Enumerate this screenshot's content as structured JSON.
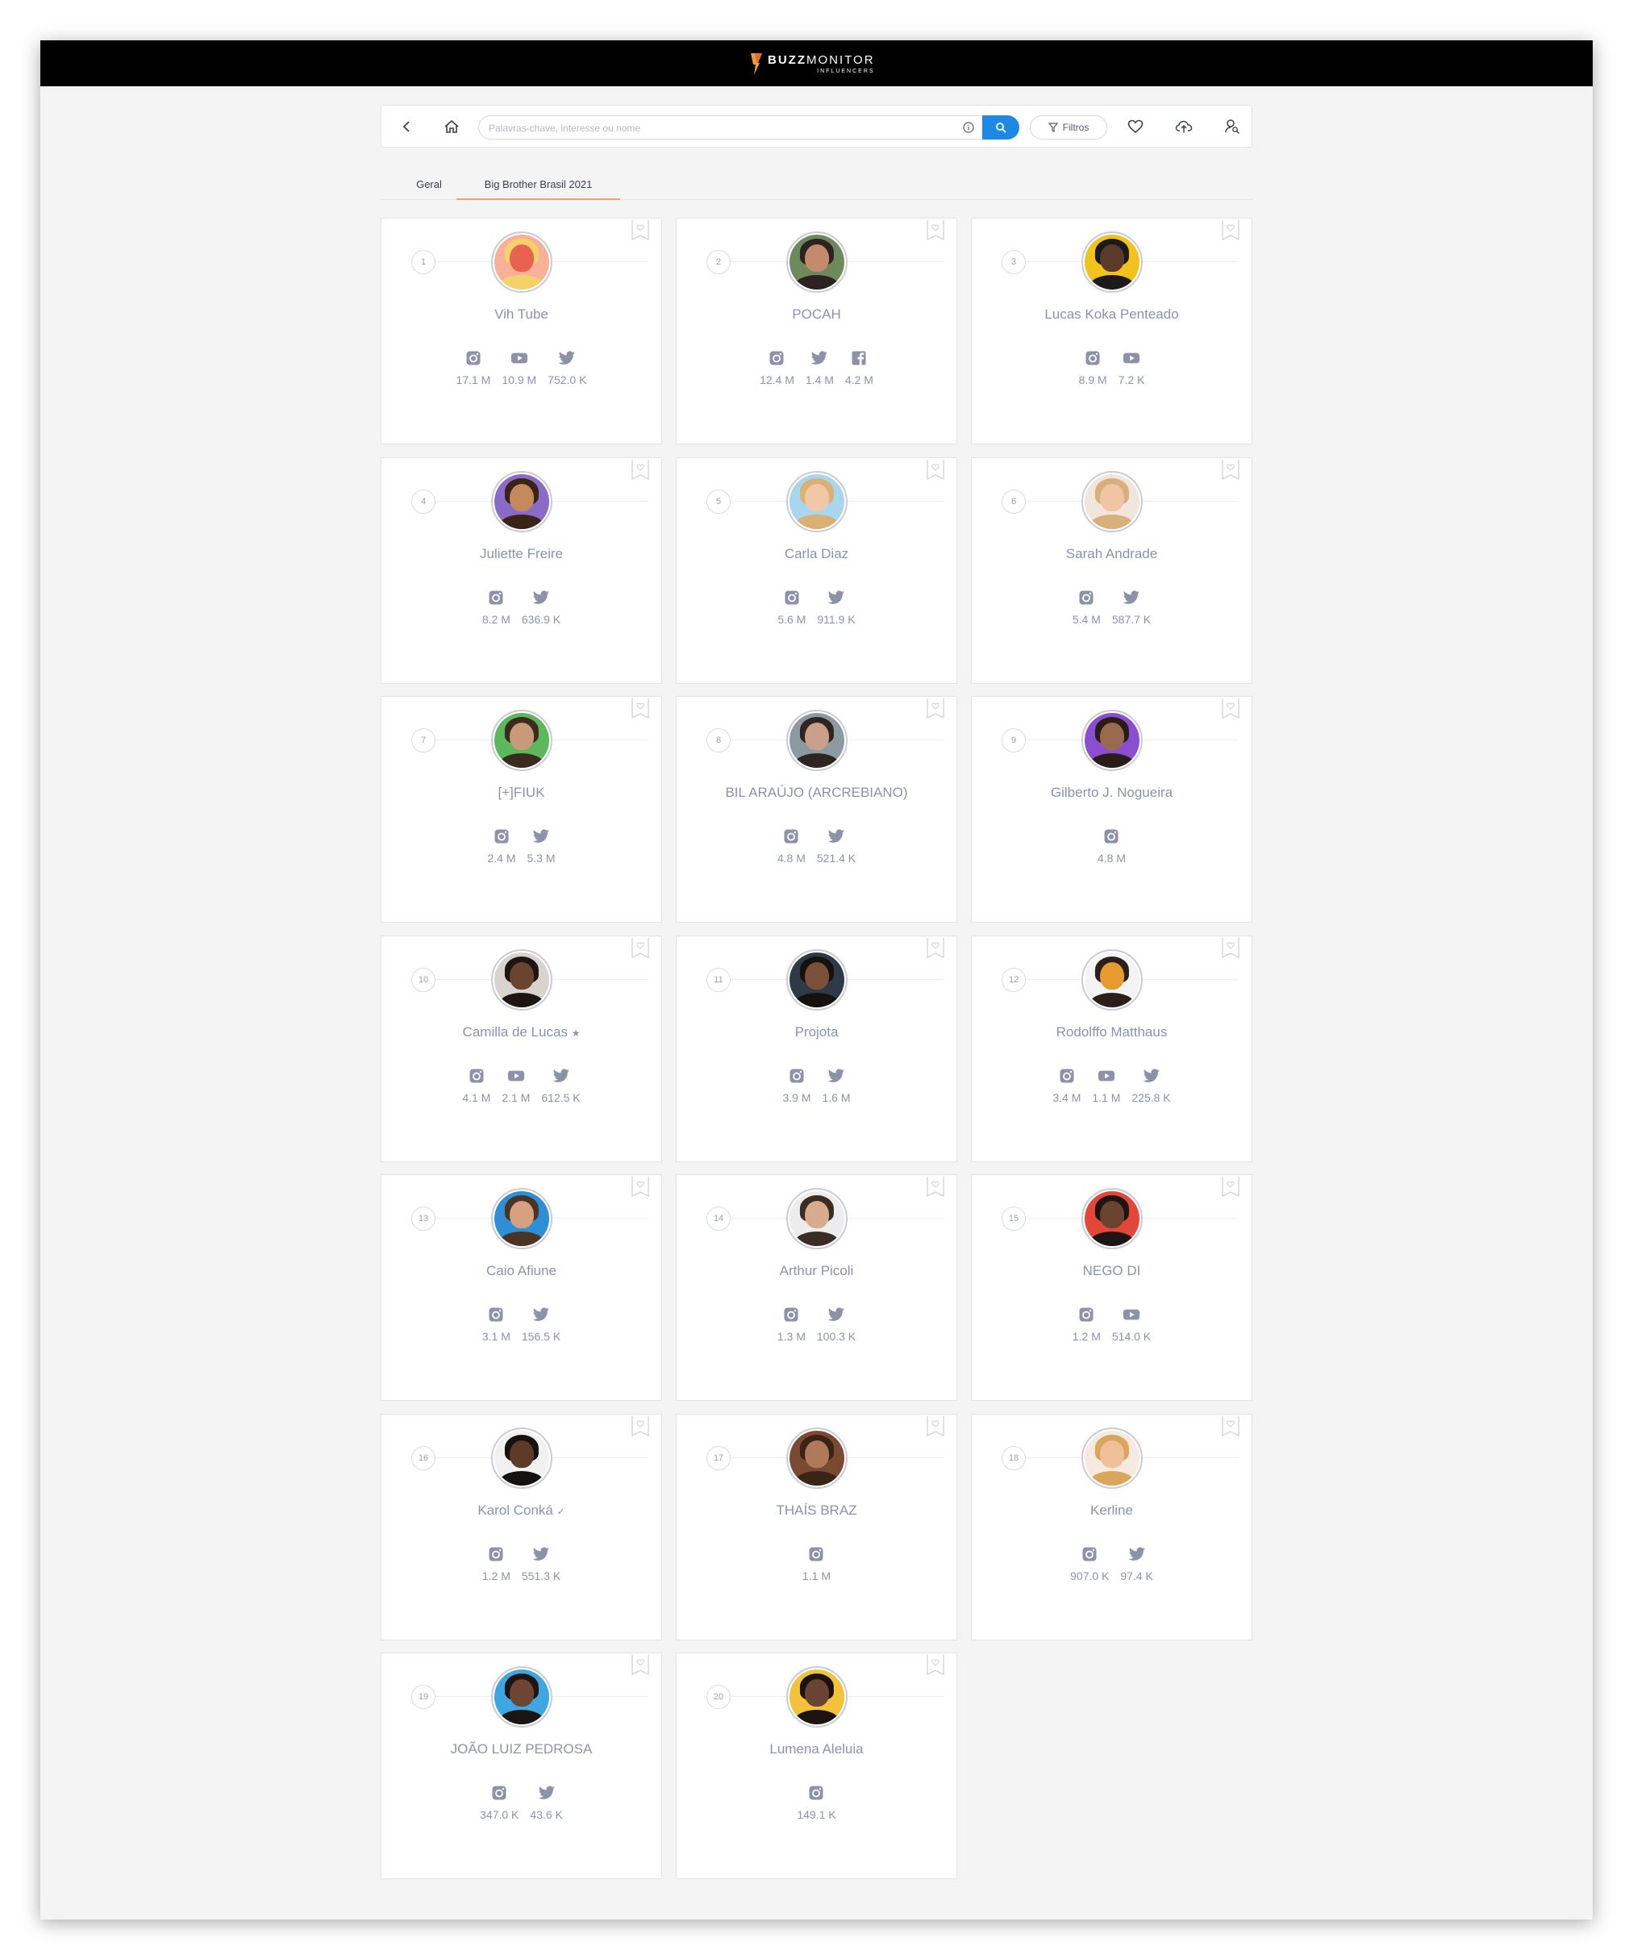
{
  "app": {
    "brand_bold": "BUZZ",
    "brand_rest": "MONITOR",
    "brand_sub": "INFLUENCERS"
  },
  "toolbar": {
    "search_placeholder": "Palavras-chave, interesse ou nome",
    "search_value": "",
    "filters_label": "Filtros"
  },
  "tabs": [
    {
      "label": "Geral",
      "active": false
    },
    {
      "label": "Big Brother Brasil 2021",
      "active": true
    }
  ],
  "influencers": [
    {
      "rank": "1",
      "name": "Vih Tube",
      "badge": "",
      "colors": [
        "#f7b199",
        "#f5d16a",
        "#e9624f"
      ],
      "stats": [
        {
          "network": "instagram-icon",
          "value": "17.1 M"
        },
        {
          "network": "youtube-icon",
          "value": "10.9 M"
        },
        {
          "network": "twitter-icon",
          "value": "752.0 K"
        }
      ]
    },
    {
      "rank": "2",
      "name": "POCAH",
      "badge": "",
      "colors": [
        "#6e8a5c",
        "#2b2320",
        "#c58a6d"
      ],
      "stats": [
        {
          "network": "instagram-icon",
          "value": "12.4 M"
        },
        {
          "network": "twitter-icon",
          "value": "1.4 M"
        },
        {
          "network": "facebook-icon",
          "value": "4.2 M"
        }
      ]
    },
    {
      "rank": "3",
      "name": "Lucas Koka Penteado",
      "badge": "",
      "colors": [
        "#f2c31a",
        "#1b1b1b",
        "#5a3a28"
      ],
      "stats": [
        {
          "network": "instagram-icon",
          "value": "8.9 M"
        },
        {
          "network": "youtube-icon",
          "value": "7.2 K"
        }
      ]
    },
    {
      "rank": "4",
      "name": "Juliette Freire",
      "badge": "",
      "colors": [
        "#8a6cc8",
        "#3a2418",
        "#c48a5c"
      ],
      "stats": [
        {
          "network": "instagram-icon",
          "value": "8.2 M"
        },
        {
          "network": "twitter-icon",
          "value": "636.9 K"
        }
      ]
    },
    {
      "rank": "5",
      "name": "Carla Diaz",
      "badge": "",
      "colors": [
        "#a9d6ee",
        "#d9b273",
        "#f0c8a8"
      ],
      "stats": [
        {
          "network": "instagram-icon",
          "value": "5.6 M"
        },
        {
          "network": "twitter-icon",
          "value": "911.9 K"
        }
      ]
    },
    {
      "rank": "6",
      "name": "Sarah Andrade",
      "badge": "",
      "colors": [
        "#f1e6dd",
        "#d8b07c",
        "#efc5a3"
      ],
      "stats": [
        {
          "network": "instagram-icon",
          "value": "5.4 M"
        },
        {
          "network": "twitter-icon",
          "value": "587.7 K"
        }
      ]
    },
    {
      "rank": "7",
      "name": "[+]FIUK",
      "badge": "",
      "colors": [
        "#5cb85c",
        "#3b2a1e",
        "#c89a78"
      ],
      "stats": [
        {
          "network": "instagram-icon",
          "value": "2.4 M"
        },
        {
          "network": "twitter-icon",
          "value": "5.3 M"
        }
      ]
    },
    {
      "rank": "8",
      "name": "BIL ARAÚJO (ARCREBIANO)",
      "badge": "",
      "colors": [
        "#8e9aa1",
        "#2e2520",
        "#caa08a"
      ],
      "stats": [
        {
          "network": "instagram-icon",
          "value": "4.8 M"
        },
        {
          "network": "twitter-icon",
          "value": "521.4 K"
        }
      ]
    },
    {
      "rank": "9",
      "name": "Gilberto J. Nogueira",
      "badge": "",
      "colors": [
        "#8a4fd1",
        "#2a1d17",
        "#9a6a4e"
      ],
      "stats": [
        {
          "network": "instagram-icon",
          "value": "4.8 M"
        }
      ]
    },
    {
      "rank": "10",
      "name": "Camilla de Lucas",
      "badge": "★",
      "colors": [
        "#d8d3cf",
        "#1c1512",
        "#6b4430"
      ],
      "stats": [
        {
          "network": "instagram-icon",
          "value": "4.1 M"
        },
        {
          "network": "youtube-icon",
          "value": "2.1 M"
        },
        {
          "network": "twitter-icon",
          "value": "612.5 K"
        }
      ]
    },
    {
      "rank": "11",
      "name": "Projota",
      "badge": "",
      "colors": [
        "#2f3a48",
        "#15110f",
        "#7a5038"
      ],
      "stats": [
        {
          "network": "instagram-icon",
          "value": "3.9 M"
        },
        {
          "network": "twitter-icon",
          "value": "1.6 M"
        }
      ]
    },
    {
      "rank": "12",
      "name": "Rodolffo Matthaus",
      "badge": "",
      "colors": [
        "#f3f3f3",
        "#2a1f1a",
        "#e59b2e"
      ],
      "stats": [
        {
          "network": "instagram-icon",
          "value": "3.4 M"
        },
        {
          "network": "youtube-icon",
          "value": "1.1 M"
        },
        {
          "network": "twitter-icon",
          "value": "225.8 K"
        }
      ]
    },
    {
      "rank": "13",
      "name": "Caio Afiune",
      "badge": "",
      "colors": [
        "#2f8fd6",
        "#4a3423",
        "#d7a080"
      ],
      "stats": [
        {
          "network": "instagram-icon",
          "value": "3.1 M"
        },
        {
          "network": "twitter-icon",
          "value": "156.5 K"
        }
      ]
    },
    {
      "rank": "14",
      "name": "Arthur Picoli",
      "badge": "",
      "colors": [
        "#ececec",
        "#3a2d24",
        "#d8ab8c"
      ],
      "stats": [
        {
          "network": "instagram-icon",
          "value": "1.3 M"
        },
        {
          "network": "twitter-icon",
          "value": "100.3 K"
        }
      ]
    },
    {
      "rank": "15",
      "name": "NEGO DI",
      "badge": "",
      "colors": [
        "#e5463a",
        "#1d1511",
        "#6a4331"
      ],
      "stats": [
        {
          "network": "instagram-icon",
          "value": "1.2 M"
        },
        {
          "network": "youtube-icon",
          "value": "514.0 K"
        }
      ]
    },
    {
      "rank": "16",
      "name": "Karol Conká",
      "badge": "✓",
      "colors": [
        "#f1f1f1",
        "#161212",
        "#5e3a28"
      ],
      "stats": [
        {
          "network": "instagram-icon",
          "value": "1.2 M"
        },
        {
          "network": "twitter-icon",
          "value": "551.3 K"
        }
      ]
    },
    {
      "rank": "17",
      "name": "THAÍS BRAZ",
      "badge": "",
      "colors": [
        "#7c4a32",
        "#3a2418",
        "#b07a5a"
      ],
      "stats": [
        {
          "network": "instagram-icon",
          "value": "1.1 M"
        }
      ]
    },
    {
      "rank": "18",
      "name": "Kerline",
      "badge": "",
      "colors": [
        "#f6e9df",
        "#d9a65c",
        "#efc09a"
      ],
      "stats": [
        {
          "network": "instagram-icon",
          "value": "907.0 K"
        },
        {
          "network": "twitter-icon",
          "value": "97.4 K"
        }
      ]
    },
    {
      "rank": "19",
      "name": "JOÃO LUIZ PEDROSA",
      "badge": "",
      "colors": [
        "#3ea6e0",
        "#1d1512",
        "#6e4532"
      ],
      "stats": [
        {
          "network": "instagram-icon",
          "value": "347.0 K"
        },
        {
          "network": "twitter-icon",
          "value": "43.6 K"
        }
      ]
    },
    {
      "rank": "20",
      "name": "Lumena Aleluia",
      "badge": "",
      "colors": [
        "#f2c33a",
        "#1a1311",
        "#6a4332"
      ],
      "stats": [
        {
          "network": "instagram-icon",
          "value": "149.1 K"
        }
      ]
    }
  ]
}
